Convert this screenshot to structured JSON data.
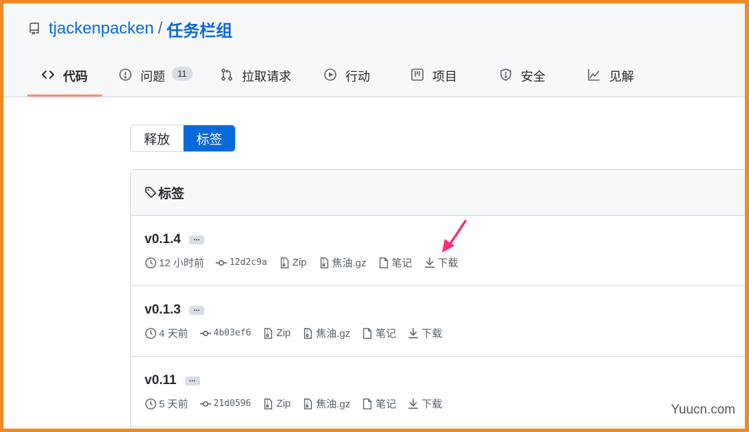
{
  "repo": {
    "owner": "tjackenpacken",
    "separator": "/",
    "name": "任务栏组"
  },
  "tabs": [
    {
      "label": "代码",
      "icon": "code-icon",
      "active": true
    },
    {
      "label": "问题",
      "icon": "issue-icon",
      "count": "11"
    },
    {
      "label": "拉取请求",
      "icon": "pull-request-icon"
    },
    {
      "label": "行动",
      "icon": "play-icon"
    },
    {
      "label": "项目",
      "icon": "project-icon"
    },
    {
      "label": "安全",
      "icon": "shield-icon"
    },
    {
      "label": "见解",
      "icon": "graph-icon"
    }
  ],
  "segmented": {
    "releases": "释放",
    "tags": "标签"
  },
  "tags_header": "标签",
  "releases": [
    {
      "version": "v0.1.4",
      "dots": "...",
      "time": "12 小时前",
      "commit": "12d2c9a",
      "zip": "Zip",
      "targz": "焦油.gz",
      "notes": "笔记",
      "download": "下载"
    },
    {
      "version": "v0.1.3",
      "dots": "...",
      "time": "4 天前",
      "commit": "4b03ef6",
      "zip": "Zip",
      "targz": "焦油.gz",
      "notes": "笔记",
      "download": "下载"
    },
    {
      "version": "v0.11",
      "dots": "...",
      "time": "5 天前",
      "commit": "21d0596",
      "zip": "Zip",
      "targz": "焦油.gz",
      "notes": "笔记",
      "download": "下载"
    }
  ],
  "watermark": "Yuucn.com",
  "colors": {
    "accent": "#0969da",
    "frame": "#f08a24",
    "tab_underline": "#fd8c73",
    "annotation_arrow": "#ff2d6f"
  }
}
